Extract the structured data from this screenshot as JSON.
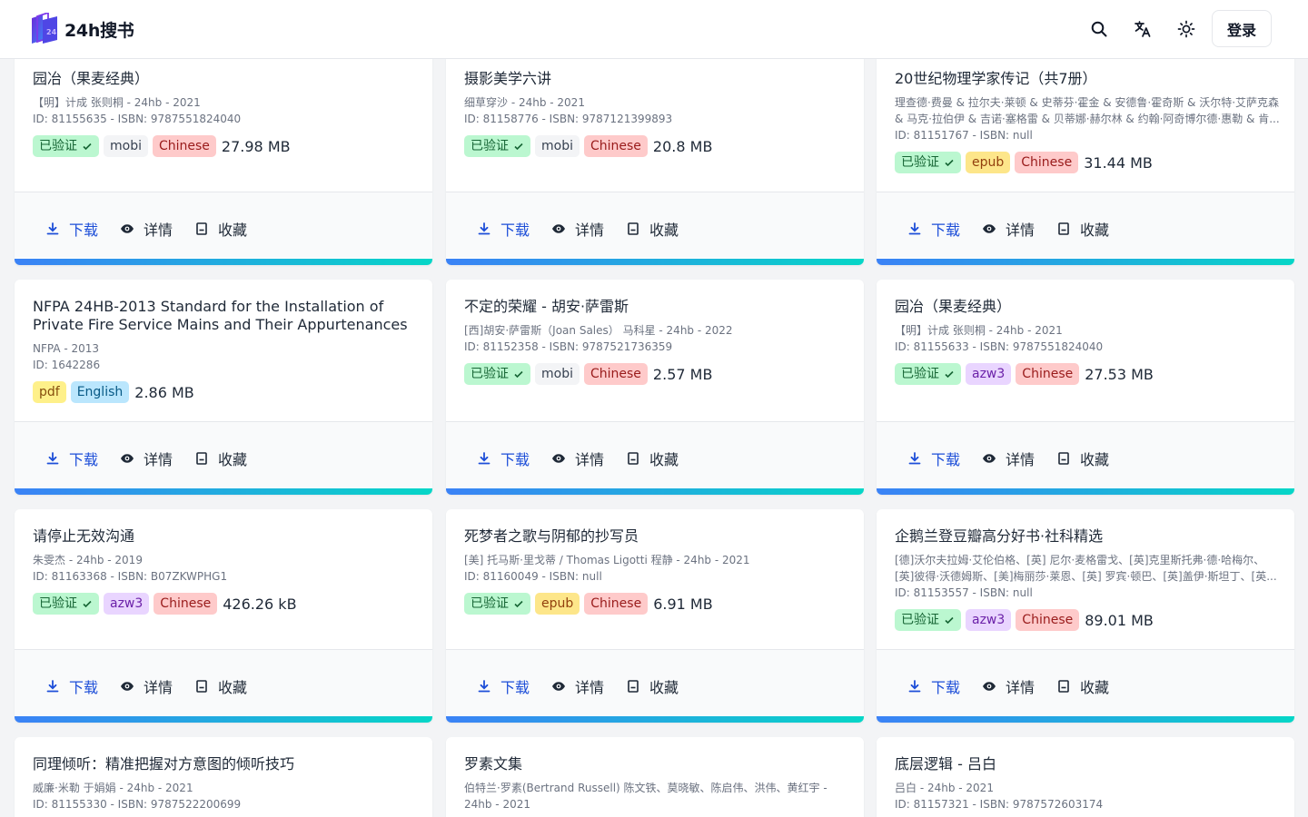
{
  "header": {
    "logo_text": "24h搜书",
    "login_label": "登录"
  },
  "icons": {
    "search": "search-icon",
    "translate": "translate-icon",
    "theme": "sun-icon"
  },
  "colors": {
    "accent_gradient_start": "#3b82f6",
    "accent_gradient_end": "#06d6c7",
    "download_blue": "#1d4ed8"
  },
  "actions": {
    "download": "下载",
    "details": "详情",
    "favorite": "收藏"
  },
  "books": [
    {
      "title": "园冶（果麦经典）",
      "author": "【明】计成 张则桐 - 24hb - 2021",
      "id_line": "ID: 81155635 - ISBN: 9787551824040",
      "verified": "已验证",
      "format": "mobi",
      "language": "Chinese",
      "size": "27.98 MB"
    },
    {
      "title": "摄影美学六讲",
      "author": "细草穿沙 - 24hb - 2021",
      "id_line": "ID: 81158776 - ISBN: 9787121399893",
      "verified": "已验证",
      "format": "mobi",
      "language": "Chinese",
      "size": "20.8 MB"
    },
    {
      "title": "20世纪物理学家传记（共7册）",
      "author": "理查德·费曼 & 拉尔夫·莱顿 & 史蒂芬·霍金 & 安德鲁·霍奇斯 & 沃尔特·艾萨克森 & 马克·拉伯伊 & 吉诺·塞格雷 & 贝蒂娜·赫尔林 & 约翰·阿奇博尔德·惠勒 & 肯...",
      "id_line": "ID: 81151767 - ISBN: null",
      "verified": "已验证",
      "format": "epub",
      "language": "Chinese",
      "size": "31.44 MB"
    },
    {
      "title": "NFPA 24HB-2013 Standard for the Installation of Private Fire Service Mains and Their Appurtenances",
      "author": "NFPA - 2013",
      "id_line": "ID: 1642286",
      "verified": "",
      "format": "pdf",
      "language": "English",
      "size": "2.86 MB"
    },
    {
      "title": "不定的荣耀 - 胡安·萨雷斯",
      "author": "[西]胡安·萨雷斯（Joan Sales） 马科星 - 24hb - 2022",
      "id_line": "ID: 81152358 - ISBN: 9787521736359",
      "verified": "已验证",
      "format": "mobi",
      "language": "Chinese",
      "size": "2.57 MB"
    },
    {
      "title": "园冶（果麦经典）",
      "author": "【明】计成 张则桐 - 24hb - 2021",
      "id_line": "ID: 81155633 - ISBN: 9787551824040",
      "verified": "已验证",
      "format": "azw3",
      "language": "Chinese",
      "size": "27.53 MB"
    },
    {
      "title": "请停止无效沟通",
      "author": "朱雯杰 - 24hb - 2019",
      "id_line": "ID: 81163368 - ISBN: B07ZKWPHG1",
      "verified": "已验证",
      "format": "azw3",
      "language": "Chinese",
      "size": "426.26 kB"
    },
    {
      "title": "死梦者之歌与阴郁的抄写员",
      "author": "[美] 托马斯·里戈蒂 / Thomas Ligotti 程静 - 24hb - 2021",
      "id_line": "ID: 81160049 - ISBN: null",
      "verified": "已验证",
      "format": "epub",
      "language": "Chinese",
      "size": "6.91 MB"
    },
    {
      "title": "企鹅兰登豆瓣高分好书·社科精选",
      "author": "[德]沃尔夫拉姆·艾伦伯格、[英] 尼尔·麦格雷戈、[英]克里斯托弗·德·哈梅尔、[英]彼得·沃德姆斯、[美]梅丽莎·莱恩、[英] 罗宾·顿巴、[英]盖伊·斯坦丁、[英...",
      "id_line": "ID: 81153557 - ISBN: null",
      "verified": "已验证",
      "format": "azw3",
      "language": "Chinese",
      "size": "89.01 MB"
    },
    {
      "title": "同理倾听：精准把握对方意图的倾听技巧",
      "author": "威廉·米勒 于娟娟 - 24hb - 2021",
      "id_line": "ID: 81155330 - ISBN: 9787522200699"
    },
    {
      "title": "罗素文集",
      "author": "伯特兰·罗素(Bertrand Russell) 陈文铁、莫晓敏、陈启伟、洪伟、黄红宇 - 24hb - 2021",
      "id_line": ""
    },
    {
      "title": "底层逻辑 - 吕白",
      "author": "吕白 - 24hb - 2021",
      "id_line": "ID: 81157321 - ISBN: 9787572603174"
    }
  ]
}
